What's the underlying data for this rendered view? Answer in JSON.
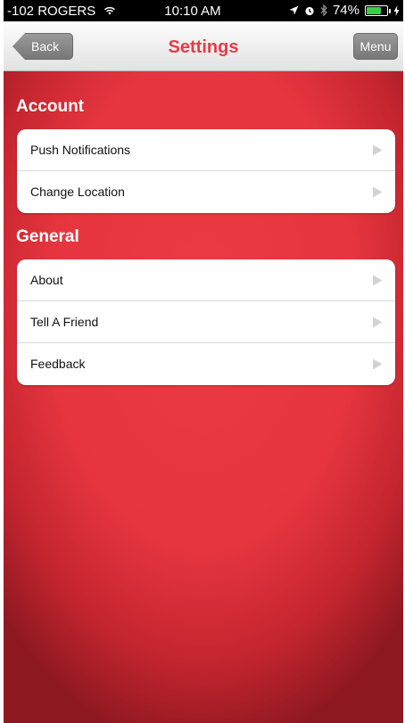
{
  "status_bar": {
    "carrier": "-102 ROGERS",
    "time": "10:10 AM",
    "battery": "74%",
    "battery_level": 0.74,
    "icons": [
      "wifi-icon",
      "location-icon",
      "alarm-icon",
      "bluetooth-icon",
      "battery-icon",
      "charging-icon"
    ]
  },
  "nav": {
    "back_label": "Back",
    "title": "Settings",
    "menu_label": "Menu"
  },
  "sections": [
    {
      "heading": "Account",
      "rows": [
        {
          "label": "Push Notifications"
        },
        {
          "label": "Change Location"
        }
      ]
    },
    {
      "heading": "General",
      "rows": [
        {
          "label": "About"
        },
        {
          "label": "Tell A Friend"
        },
        {
          "label": "Feedback"
        }
      ]
    }
  ],
  "colors": {
    "accent": "#e63b45",
    "background": "#e6353f",
    "battery_green": "#35d046"
  }
}
